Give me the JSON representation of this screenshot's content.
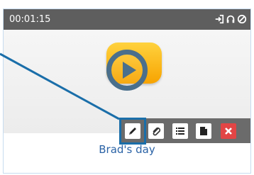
{
  "player": {
    "time": "00:01:15",
    "title": "Brad's day"
  },
  "topbar_icons": [
    "login-icon",
    "headphones-icon",
    "disabled-icon"
  ],
  "toolbar": {
    "buttons": [
      {
        "name": "edit",
        "icon": "pencil-icon"
      },
      {
        "name": "attach",
        "icon": "paperclip-icon"
      },
      {
        "name": "list",
        "icon": "list-icon"
      },
      {
        "name": "document",
        "icon": "document-icon"
      },
      {
        "name": "delete",
        "icon": "close-icon"
      }
    ]
  },
  "colors": {
    "topbar": "#5e5e5e",
    "toolbar": "#6b6b6b",
    "highlight": "#1a6ea9",
    "title": "#2b63a6",
    "delete": "#e24545",
    "tile": "#f7a300",
    "play": "#4a6f8c"
  }
}
